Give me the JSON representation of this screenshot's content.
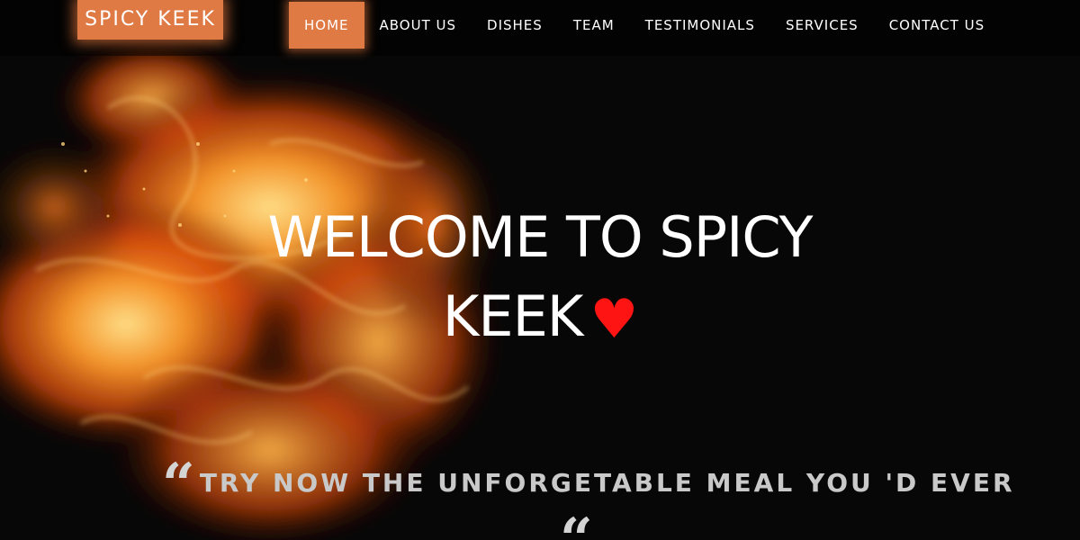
{
  "header": {
    "logo_text": "SPICY KEEK",
    "nav": [
      {
        "label": "HOME",
        "active": true
      },
      {
        "label": "ABOUT US",
        "active": false
      },
      {
        "label": "DISHES",
        "active": false
      },
      {
        "label": "TEAM",
        "active": false
      },
      {
        "label": "TESTIMONIALS",
        "active": false
      },
      {
        "label": "SERVICES",
        "active": false
      },
      {
        "label": "CONTACT US",
        "active": false
      }
    ]
  },
  "hero": {
    "title_line1": "WELCOME TO SPICY",
    "title_line2": "KEEK",
    "heart_icon": "heart-icon",
    "tagline_open_quote": "“",
    "tagline": "TRY NOW THE UNFORGETABLE MEAL YOU 'D EVER",
    "tagline_close_quote": "“"
  },
  "colors": {
    "accent": "#e07a45",
    "heart": "#ff1414",
    "background": "#070707"
  }
}
